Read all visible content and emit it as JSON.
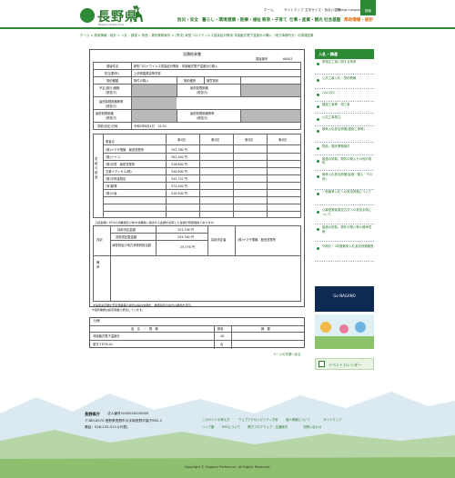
{
  "header": {
    "logo_text": "長野県",
    "logo_sub": "Nagano Prefecture",
    "utils": [
      "ホーム",
      "サイトマップ",
      "文字サイズ・色合い変更",
      "Foreign Language"
    ],
    "search_label": "検索",
    "nav": [
      "防災・安全",
      "暮らし・環境",
      "健康・医療・福祉",
      "教育・子育て",
      "仕事・産業・観光",
      "社会基盤",
      "県政情報・統計"
    ]
  },
  "breadcrumb": "ホーム > 県政情報・統計 > 入札・調達 > 物品・委託業務案件 > [専決]  新型コロナウイルス感染症対策用  非接触式電子温度計の購入（地方事務所分）の調達結果",
  "doc": {
    "title": "見積結果書",
    "number_label": "調達番号",
    "number": "60001",
    "rows": {
      "name_label": "調達件名",
      "name": "新型コロナウイルス感染症対策用　非接触式電子温度計の購入",
      "office_label": "担当課(所)",
      "office": "上伊那農業高等学校",
      "contract_type_label": "契約種類",
      "contract_type": "物件の購入",
      "method_label": "契約種別",
      "method": "随意契約",
      "estimate_label": "予定(設計)価格",
      "low_label": "最低制限価格",
      "rate_label": "最低制限価格等率",
      "contract_date_label": "(税抜き)",
      "sub_note": "(税抜き)",
      "date_label": "見積(決定)日時",
      "date": "令和2年6月4日　14:30"
    },
    "vertical_label": "見積の経過",
    "round_headers": [
      "第1回",
      "第2回",
      "第3回",
      "第4回"
    ],
    "bidder_label": "業者名",
    "bids": [
      {
        "name": "(株)ヤマザ電機　飯田営業所",
        "v": "293,760 円"
      },
      {
        "name": "(株)ミヤコ",
        "v": "302,400 円"
      },
      {
        "name": "(株)光賀　飯田営業所",
        "v": "316,800 円"
      },
      {
        "name": "玉置メディカル(株)",
        "v": "340,800 円"
      },
      {
        "name": "(株)平林金物店",
        "v": "345,752 円"
      },
      {
        "name": "(有)藤澤",
        "v": "374,400 円"
      },
      {
        "name": "(株)小坂",
        "v": "410,400 円"
      }
    ],
    "note_tax": "上記金額に10%の消費税及び地方消費税に相当する金額を加算した金額が見積価格であります。",
    "contract_label": "内訳",
    "contract_rows": [
      {
        "k": "採用決定金額",
        "v": "323,136 円"
      },
      {
        "k": "見積書記載金額",
        "v": "293,760 円"
      },
      {
        "k": "消費税及び地方消費税相当額",
        "v": "29,376 円"
      }
    ],
    "winner_label": "採用決定者",
    "winner": "(株)ヤマザ電機　飯田営業所",
    "remarks_label": "備考",
    "footnote1": "※採用決定額を予定価格等の場合は設計金額を、単価契約の場合は単価を表示。",
    "footnote2": "※契約種類は指定調整で調達しています。",
    "spec_title": "仕様",
    "spec_headers": [
      "品　名　／　規　格",
      "数量",
      "摘　要"
    ],
    "spec_rows": [
      {
        "name": "非接触式電子温度計",
        "qty": "40",
        "note": ""
      },
      {
        "name": "型式:TETM-01",
        "qty": "台",
        "note": ""
      }
    ]
  },
  "page_top": "ページの先頭へ戻る",
  "sidebar": {
    "heading": "入札・調達",
    "items": [
      "県発注工事に関する条例",
      "公共工事入札・契約情報",
      "CALS/EC",
      "建設工事等・測工事",
      "公共工事発注",
      "競争入札参加資格(建設工事等)",
      "物品・委託業務案件",
      "製造の請負、物件の購入その他の契約",
      "競争入札参加資格(製造・購入・その他)",
      "一般競争入札への参加資格について",
      "公募型業者選定方式への参加手続について",
      "製造の請負、物件の購入等の競争見積",
      "令和元・2年度競争入札参加資格審査"
    ],
    "banner_text": "Go NAGANO",
    "calendar": "イベントカレンダー"
  },
  "footer": {
    "org": "長野県庁",
    "corp_no": "法人番号1000020200000",
    "address": "〒380-8570 長野県長野市大字南長野字幅下692-2",
    "tel": "電話：026-232-0111(代表)",
    "links": [
      "このサイトの考え方",
      "ウェブアクセシビリティ方針",
      "個人情報について",
      "サイトマップ",
      "リンク集",
      "RSSについて",
      "県庁フロアマップ・交通案内",
      "お問い合わせ"
    ],
    "copyright": "Copyright © Nagano Prefecture. All Rights Reserved."
  },
  "colors": {
    "brand_green": "#2c8a36",
    "active_orange": "#e06a12",
    "navy": "#0f2a52"
  }
}
